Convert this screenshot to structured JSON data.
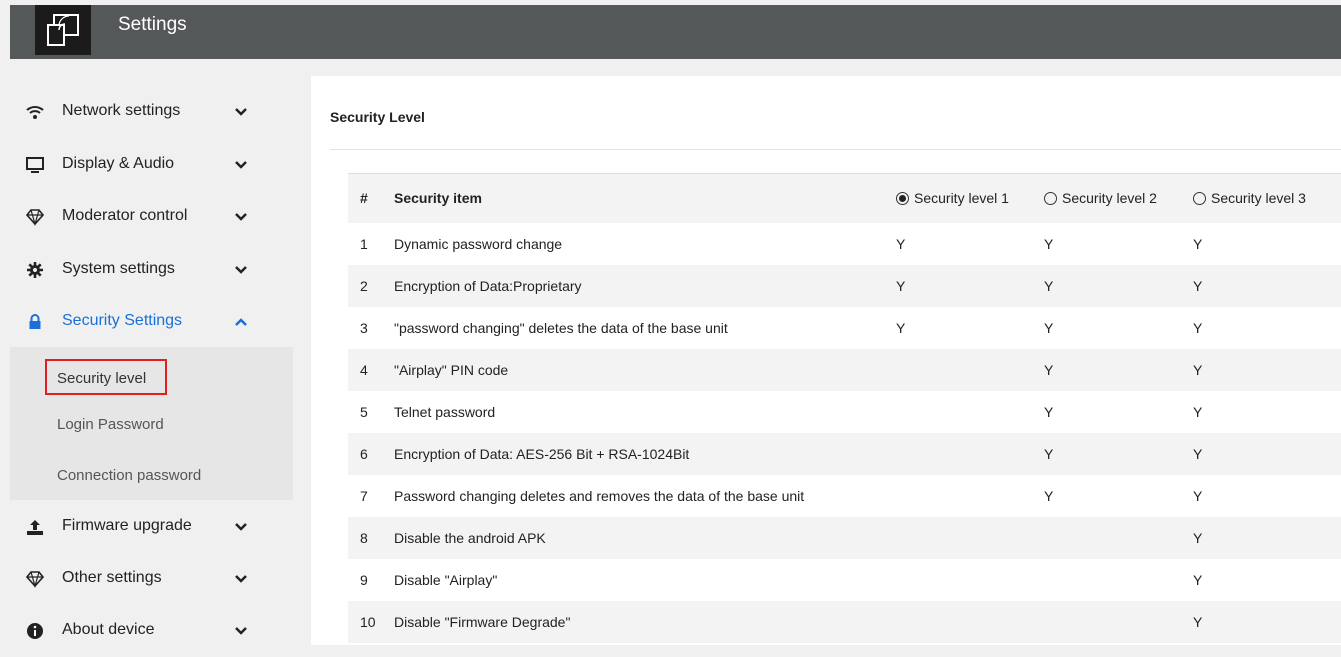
{
  "app": {
    "title": "Settings"
  },
  "sidebar": {
    "items": [
      {
        "label": "Network settings",
        "icon": "wifi-icon",
        "expanded": false
      },
      {
        "label": "Display & Audio",
        "icon": "monitor-icon",
        "expanded": false
      },
      {
        "label": "Moderator control",
        "icon": "diamond-icon",
        "expanded": false
      },
      {
        "label": "System settings",
        "icon": "gear-icon",
        "expanded": false
      },
      {
        "label": "Security Settings",
        "icon": "lock-icon",
        "expanded": true,
        "active": true
      },
      {
        "label": "Firmware upgrade",
        "icon": "upload-icon",
        "expanded": false
      },
      {
        "label": "Other settings",
        "icon": "diamond-icon",
        "expanded": false
      },
      {
        "label": "About device",
        "icon": "info-icon",
        "expanded": false
      }
    ],
    "security_sub": [
      {
        "label": "Security level",
        "selected": true
      },
      {
        "label": "Login Password"
      },
      {
        "label": "Connection password"
      }
    ]
  },
  "main": {
    "title": "Security Level",
    "table": {
      "headers": {
        "num": "#",
        "item": "Security item",
        "level1": "Security level 1",
        "level2": "Security level 2",
        "level3": "Security level 3"
      },
      "selected_level": 1,
      "rows": [
        {
          "num": "1",
          "item": "Dynamic password change",
          "l1": "Y",
          "l2": "Y",
          "l3": "Y"
        },
        {
          "num": "2",
          "item": "Encryption of Data:Proprietary",
          "l1": "Y",
          "l2": "Y",
          "l3": "Y"
        },
        {
          "num": "3",
          "item": "\"password changing\" deletes the data of the base unit",
          "l1": "Y",
          "l2": "Y",
          "l3": "Y"
        },
        {
          "num": "4",
          "item": "\"Airplay\" PIN code",
          "l1": "",
          "l2": "Y",
          "l3": "Y"
        },
        {
          "num": "5",
          "item": "Telnet password",
          "l1": "",
          "l2": "Y",
          "l3": "Y"
        },
        {
          "num": "6",
          "item": "Encryption of Data: AES-256 Bit + RSA-1024Bit",
          "l1": "",
          "l2": "Y",
          "l3": "Y"
        },
        {
          "num": "7",
          "item": "Password changing deletes and removes the data of the base unit",
          "l1": "",
          "l2": "Y",
          "l3": "Y"
        },
        {
          "num": "8",
          "item": "Disable the android APK",
          "l1": "",
          "l2": "",
          "l3": "Y"
        },
        {
          "num": "9",
          "item": "Disable \"Airplay\"",
          "l1": "",
          "l2": "",
          "l3": "Y"
        },
        {
          "num": "10",
          "item": "Disable \"Firmware Degrade\"",
          "l1": "",
          "l2": "",
          "l3": "Y"
        }
      ]
    }
  },
  "colors": {
    "topbar": "#555859",
    "active": "#1a6fd8",
    "highlight_border": "#e02020"
  }
}
